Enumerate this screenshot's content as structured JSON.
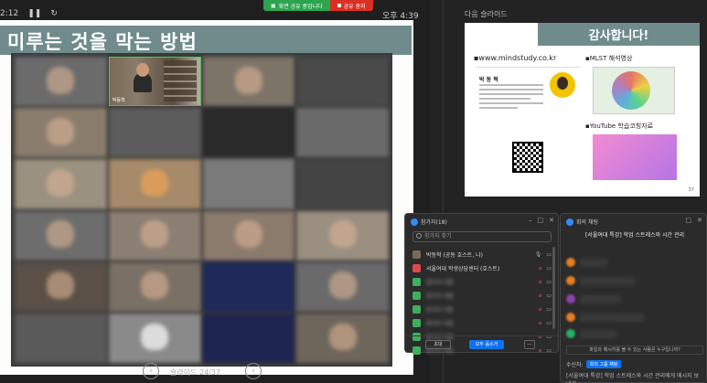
{
  "share_bar": {
    "sharing_label": "화면 공유 중입니다",
    "stop_label": "공유 중지"
  },
  "presenter": {
    "timer": "2:12",
    "pause_icon": "pause-icon",
    "clock": "오후 4:39",
    "slide_title": "미루는 것을 막는 방법",
    "slide_counter": "슬라이드 24/37"
  },
  "gallery": {
    "sharp_tile_label": "박동혁"
  },
  "next_slide": {
    "label": "다음 슬라이드",
    "title": "감사합니다!",
    "url": "▪www.mindstudy.co.kr",
    "card_name": "박 동 혁",
    "mlst": "▪MLST 해석영상",
    "youtube": "▪YouTube 학습코칭자료",
    "page": "37"
  },
  "participants": {
    "title": "참가자(18)",
    "search_placeholder": "참가자 찾기",
    "rows": [
      {
        "name": "박동혁 (공동 호스트, 나)",
        "color": "#7a6a58"
      },
      {
        "name": "서울여대 학생상담센터 (호스트)",
        "color": "#e04a4a"
      },
      {
        "name": "참가자 이름",
        "color": "#3fae5e"
      },
      {
        "name": "참가자 이름",
        "color": "#3fae5e"
      },
      {
        "name": "참가자 이름",
        "color": "#3fae5e"
      },
      {
        "name": "참가자 이름",
        "color": "#3fae5e"
      },
      {
        "name": "참가자 이름",
        "color": "#3fae5e"
      },
      {
        "name": "참가자 이름",
        "color": "#3fae5e"
      }
    ],
    "invite_label": "초대",
    "mute_all_label": "모두 음소거",
    "more_label": "..."
  },
  "chat": {
    "title": "회의 채팅",
    "heading": "[서울여대 특강] 학업 스트레스와 시간 관리",
    "notice": "파일과 메시지를 볼 수 있는 사람은 누구입니까?",
    "to_label": "수신자:",
    "to_value": "회의 그룹 채팅",
    "input_text": "[서울여대 특강] 학업 스트레스와 시간 관리에게 메시지 보내기"
  },
  "icons": {
    "camera_icon": "camera-icon",
    "mic_muted_icon": "mic-muted-icon",
    "close_icon": "close-icon"
  }
}
